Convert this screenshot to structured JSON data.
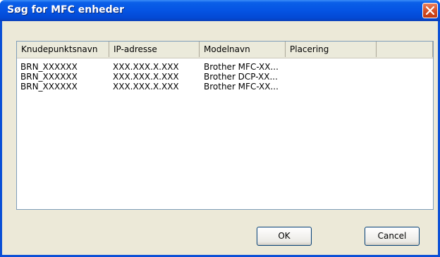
{
  "window": {
    "title": "Søg for MFC enheder"
  },
  "table": {
    "columns": [
      "Knudepunktsnavn",
      "IP-adresse",
      "Modelnavn",
      "Placering"
    ],
    "rows": [
      [
        "BRN_XXXXXX",
        "XXX.XXX.X.XXX",
        "Brother MFC-XX...",
        ""
      ],
      [
        "BRN_XXXXXX",
        "XXX.XXX.X.XXX",
        "Brother DCP-XX...",
        ""
      ],
      [
        "BRN_XXXXXX",
        "XXX.XXX.X.XXX",
        "Brother MFC-XX...",
        ""
      ]
    ]
  },
  "buttons": {
    "ok": "OK",
    "cancel": "Cancel"
  },
  "icons": {
    "close": "close-icon"
  },
  "colors": {
    "titlebar": "#0554e3",
    "close": "#d34d24",
    "dialog_bg": "#ece9d8"
  }
}
